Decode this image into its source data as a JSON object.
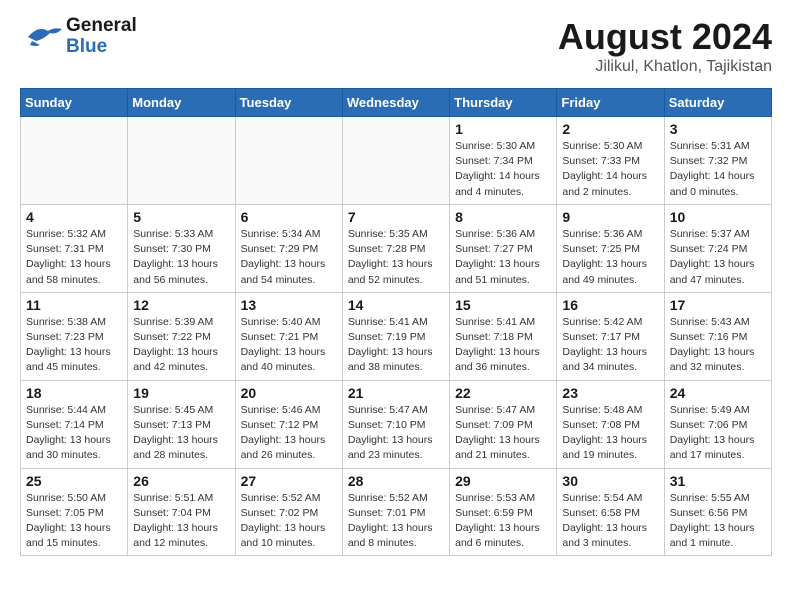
{
  "header": {
    "logo_general": "General",
    "logo_blue": "Blue",
    "main_title": "August 2024",
    "sub_title": "Jilikul, Khatlon, Tajikistan"
  },
  "calendar": {
    "weekdays": [
      "Sunday",
      "Monday",
      "Tuesday",
      "Wednesday",
      "Thursday",
      "Friday",
      "Saturday"
    ],
    "weeks": [
      [
        {
          "day": "",
          "info": ""
        },
        {
          "day": "",
          "info": ""
        },
        {
          "day": "",
          "info": ""
        },
        {
          "day": "",
          "info": ""
        },
        {
          "day": "1",
          "info": "Sunrise: 5:30 AM\nSunset: 7:34 PM\nDaylight: 14 hours\nand 4 minutes."
        },
        {
          "day": "2",
          "info": "Sunrise: 5:30 AM\nSunset: 7:33 PM\nDaylight: 14 hours\nand 2 minutes."
        },
        {
          "day": "3",
          "info": "Sunrise: 5:31 AM\nSunset: 7:32 PM\nDaylight: 14 hours\nand 0 minutes."
        }
      ],
      [
        {
          "day": "4",
          "info": "Sunrise: 5:32 AM\nSunset: 7:31 PM\nDaylight: 13 hours\nand 58 minutes."
        },
        {
          "day": "5",
          "info": "Sunrise: 5:33 AM\nSunset: 7:30 PM\nDaylight: 13 hours\nand 56 minutes."
        },
        {
          "day": "6",
          "info": "Sunrise: 5:34 AM\nSunset: 7:29 PM\nDaylight: 13 hours\nand 54 minutes."
        },
        {
          "day": "7",
          "info": "Sunrise: 5:35 AM\nSunset: 7:28 PM\nDaylight: 13 hours\nand 52 minutes."
        },
        {
          "day": "8",
          "info": "Sunrise: 5:36 AM\nSunset: 7:27 PM\nDaylight: 13 hours\nand 51 minutes."
        },
        {
          "day": "9",
          "info": "Sunrise: 5:36 AM\nSunset: 7:25 PM\nDaylight: 13 hours\nand 49 minutes."
        },
        {
          "day": "10",
          "info": "Sunrise: 5:37 AM\nSunset: 7:24 PM\nDaylight: 13 hours\nand 47 minutes."
        }
      ],
      [
        {
          "day": "11",
          "info": "Sunrise: 5:38 AM\nSunset: 7:23 PM\nDaylight: 13 hours\nand 45 minutes."
        },
        {
          "day": "12",
          "info": "Sunrise: 5:39 AM\nSunset: 7:22 PM\nDaylight: 13 hours\nand 42 minutes."
        },
        {
          "day": "13",
          "info": "Sunrise: 5:40 AM\nSunset: 7:21 PM\nDaylight: 13 hours\nand 40 minutes."
        },
        {
          "day": "14",
          "info": "Sunrise: 5:41 AM\nSunset: 7:19 PM\nDaylight: 13 hours\nand 38 minutes."
        },
        {
          "day": "15",
          "info": "Sunrise: 5:41 AM\nSunset: 7:18 PM\nDaylight: 13 hours\nand 36 minutes."
        },
        {
          "day": "16",
          "info": "Sunrise: 5:42 AM\nSunset: 7:17 PM\nDaylight: 13 hours\nand 34 minutes."
        },
        {
          "day": "17",
          "info": "Sunrise: 5:43 AM\nSunset: 7:16 PM\nDaylight: 13 hours\nand 32 minutes."
        }
      ],
      [
        {
          "day": "18",
          "info": "Sunrise: 5:44 AM\nSunset: 7:14 PM\nDaylight: 13 hours\nand 30 minutes."
        },
        {
          "day": "19",
          "info": "Sunrise: 5:45 AM\nSunset: 7:13 PM\nDaylight: 13 hours\nand 28 minutes."
        },
        {
          "day": "20",
          "info": "Sunrise: 5:46 AM\nSunset: 7:12 PM\nDaylight: 13 hours\nand 26 minutes."
        },
        {
          "day": "21",
          "info": "Sunrise: 5:47 AM\nSunset: 7:10 PM\nDaylight: 13 hours\nand 23 minutes."
        },
        {
          "day": "22",
          "info": "Sunrise: 5:47 AM\nSunset: 7:09 PM\nDaylight: 13 hours\nand 21 minutes."
        },
        {
          "day": "23",
          "info": "Sunrise: 5:48 AM\nSunset: 7:08 PM\nDaylight: 13 hours\nand 19 minutes."
        },
        {
          "day": "24",
          "info": "Sunrise: 5:49 AM\nSunset: 7:06 PM\nDaylight: 13 hours\nand 17 minutes."
        }
      ],
      [
        {
          "day": "25",
          "info": "Sunrise: 5:50 AM\nSunset: 7:05 PM\nDaylight: 13 hours\nand 15 minutes."
        },
        {
          "day": "26",
          "info": "Sunrise: 5:51 AM\nSunset: 7:04 PM\nDaylight: 13 hours\nand 12 minutes."
        },
        {
          "day": "27",
          "info": "Sunrise: 5:52 AM\nSunset: 7:02 PM\nDaylight: 13 hours\nand 10 minutes."
        },
        {
          "day": "28",
          "info": "Sunrise: 5:52 AM\nSunset: 7:01 PM\nDaylight: 13 hours\nand 8 minutes."
        },
        {
          "day": "29",
          "info": "Sunrise: 5:53 AM\nSunset: 6:59 PM\nDaylight: 13 hours\nand 6 minutes."
        },
        {
          "day": "30",
          "info": "Sunrise: 5:54 AM\nSunset: 6:58 PM\nDaylight: 13 hours\nand 3 minutes."
        },
        {
          "day": "31",
          "info": "Sunrise: 5:55 AM\nSunset: 6:56 PM\nDaylight: 13 hours\nand 1 minute."
        }
      ]
    ]
  }
}
